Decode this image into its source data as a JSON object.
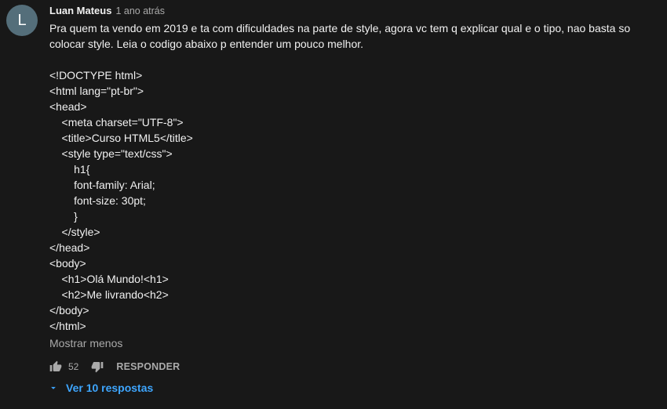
{
  "comment": {
    "avatar_letter": "L",
    "author": "Luan Mateus",
    "time": "1 ano atrás",
    "intro": "Pra quem ta vendo em 2019 e ta com dificuldades na parte de style, agora vc tem q explicar qual e o tipo, nao basta so colocar style. Leia o codigo abaixo p entender um pouco melhor.",
    "code_lines": [
      "<!DOCTYPE html>",
      "<html lang=\"pt-br\">",
      "<head>",
      "    <meta charset=\"UTF-8\">",
      "    <title>Curso HTML5</title>",
      "    <style type=\"text/css\">",
      "        h1{",
      "        font-family: Arial;",
      "        font-size: 30pt;",
      "        }",
      "    </style>",
      "</head>",
      "<body>",
      "    <h1>Olá Mundo!<h1>",
      "    <h2>Me livrando<h2>",
      "</body>",
      "</html>"
    ],
    "show_less_label": "Mostrar menos",
    "like_count": "52",
    "reply_label": "RESPONDER",
    "view_replies_label": "Ver 10 respostas"
  },
  "colors": {
    "background": "#181818",
    "text": "#f1f1f1",
    "secondary_text": "#aaaaaa",
    "link_blue": "#3ea6ff",
    "avatar_bg": "#546e7a"
  },
  "icons": {
    "like": "thumb-up-icon",
    "dislike": "thumb-down-icon",
    "expand": "caret-down-icon"
  }
}
